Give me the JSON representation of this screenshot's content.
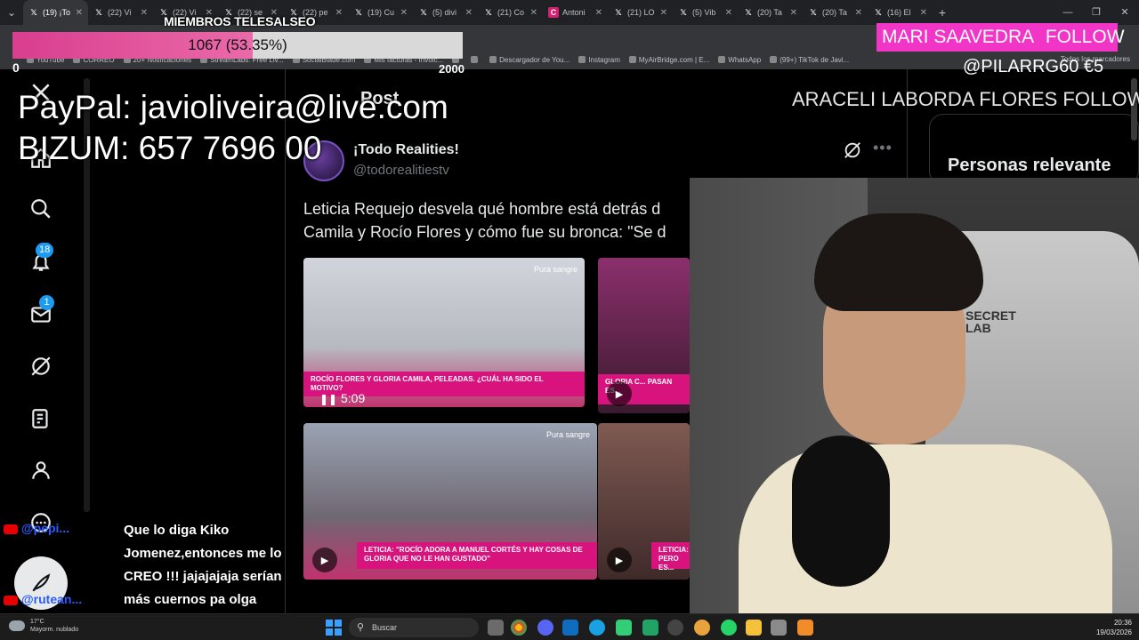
{
  "browser": {
    "tabs": [
      {
        "label": "(19) ¡To",
        "icon": "x-icon",
        "active": true
      },
      {
        "label": "(22) Vi",
        "icon": "x-icon"
      },
      {
        "label": "(22) Vi",
        "icon": "x-icon"
      },
      {
        "label": "(22) se",
        "icon": "x-icon"
      },
      {
        "label": "(22) pe",
        "icon": "x-icon"
      },
      {
        "label": "(19) Cu",
        "icon": "x-icon"
      },
      {
        "label": "(5) divi",
        "icon": "x-icon"
      },
      {
        "label": "(21) Co",
        "icon": "x-icon"
      },
      {
        "label": "Antoni",
        "icon": "c-icon"
      },
      {
        "label": "(21) LO",
        "icon": "x-icon"
      },
      {
        "label": "(5) Vib",
        "icon": "x-icon"
      },
      {
        "label": "(20) Ta",
        "icon": "x-icon"
      },
      {
        "label": "(20) Ta",
        "icon": "x-icon"
      },
      {
        "label": "(16) El",
        "icon": "x-icon"
      }
    ],
    "new_tab": "+",
    "bookmarks": [
      "YouTube",
      "CORREO",
      "20+ Notificaciones",
      "StreamLabs: Free Liv...",
      "SocialBlade.com",
      "Mis facturas - Invoic...",
      "",
      "",
      "Descargador de You...",
      "Instagram",
      "MyAirBridge.com | E...",
      "WhatsApp",
      "(99+) TikTok de Javi..."
    ],
    "bookmarks_all": "Todos los marcadores"
  },
  "x": {
    "post_heading": "Post",
    "author_name": "¡Todo Realities!",
    "author_handle": "@todorealitiestv",
    "post_text_line1": "Leticia Requejo desvela qué hombre está detrás d",
    "post_text_line2": "Camila y Rocío Flores y cómo fue su bronca: \"Se d",
    "video_duration": "5:09",
    "media": [
      {
        "caption": "ROCÍO FLORES Y GLORIA CAMILA, PELEADAS. ¿CUÁL HA SIDO EL MOTIVO?",
        "tag": "Pura sangre"
      },
      {
        "caption": "GLORIA C... PASAN ES...",
        "tag": ""
      },
      {
        "caption": "LETICIA: \"ROCÍO ADORA A MANUEL CORTÉS Y HAY COSAS DE GLORIA QUE NO LE HAN GUSTADO\"",
        "tag": "Pura sangre"
      },
      {
        "caption": "LETICIA: PERO ES...",
        "tag": ""
      }
    ],
    "notifications_badge": "18",
    "messages_badge": "1",
    "relevant_title": "Personas relevante"
  },
  "overlay": {
    "members_title": "MIEMBROS TELESALSEO",
    "goal_label": "1067 (53.35%)",
    "goal_fraction": 0.5335,
    "goal_min": "0",
    "goal_max": "2000",
    "donation_line1": "PayPal: javioliveira@live.com",
    "donation_line2": "BIZUM: 657 7696 00",
    "follow_name": "MARI SAAVEDRA",
    "follow_word": "FOLLOW",
    "donor": "@PILARRG60  €5",
    "follow2": "ARACELI LABORDA FLORES  FOLLOW",
    "webcam_chair_text": "SECRET\nLAB",
    "chat_users": [
      "@pepi...",
      "@rutean..."
    ],
    "chat_message": "Que lo diga Kiko Jomenez,entonces me lo CREO !!! jajajajaja serían más cuernos pa olga"
  },
  "taskbar": {
    "weather_temp": "17°C",
    "weather_desc": "Mayorm. nublado",
    "search_placeholder": "Buscar",
    "time": "20:36",
    "date": "19/03/2026"
  },
  "colors": {
    "accent_blue": "#1d9bf0",
    "goal_pink": "#e8559f",
    "follow_magenta": "#f035c7",
    "media_pink": "#d8137d"
  }
}
